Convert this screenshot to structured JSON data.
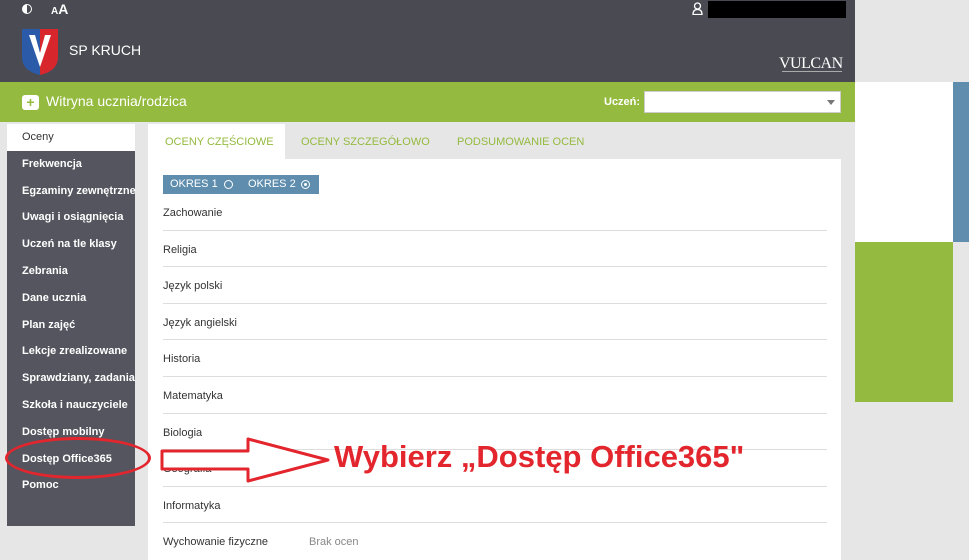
{
  "header": {
    "font_size_small": "A",
    "font_size_large": "A",
    "school_name": "SP KRUCH",
    "vendor_logo": "VULCAN"
  },
  "site": {
    "title": "Witryna ucznia/rodzica",
    "student_label": "Uczeń:",
    "student_value": ""
  },
  "sidebar": {
    "items": [
      {
        "label": "Oceny"
      },
      {
        "label": "Frekwencja"
      },
      {
        "label": "Egzaminy zewnętrzne"
      },
      {
        "label": "Uwagi i osiągnięcia"
      },
      {
        "label": "Uczeń na tle klasy"
      },
      {
        "label": "Zebrania"
      },
      {
        "label": "Dane ucznia"
      },
      {
        "label": "Plan zajęć"
      },
      {
        "label": "Lekcje zrealizowane"
      },
      {
        "label": "Sprawdziany, zadania"
      },
      {
        "label": "Szkoła i nauczyciele"
      },
      {
        "label": "Dostęp mobilny"
      },
      {
        "label": "Dostęp Office365"
      },
      {
        "label": "Pomoc"
      }
    ]
  },
  "tabs": [
    {
      "label": "OCENY CZĘŚCIOWE"
    },
    {
      "label": "OCENY SZCZEGÓŁOWO"
    },
    {
      "label": "PODSUMOWANIE OCEN"
    }
  ],
  "periods": [
    {
      "label": "OKRES 1",
      "selected": false
    },
    {
      "label": "OKRES 2",
      "selected": true
    }
  ],
  "subjects": [
    {
      "name": "Zachowanie",
      "grades": ""
    },
    {
      "name": "Religia",
      "grades": ""
    },
    {
      "name": "Język polski",
      "grades": ""
    },
    {
      "name": "Język angielski",
      "grades": ""
    },
    {
      "name": "Historia",
      "grades": ""
    },
    {
      "name": "Matematyka",
      "grades": ""
    },
    {
      "name": "Biologia",
      "grades": ""
    },
    {
      "name": "Geografia",
      "grades": ""
    },
    {
      "name": "Informatyka",
      "grades": ""
    },
    {
      "name": "Wychowanie fizyczne",
      "grades": "Brak ocen"
    }
  ],
  "annotation": {
    "text": "Wybierz „Dostęp Office365\"",
    "color": "#e3262d"
  },
  "colors": {
    "header_dark": "#4a4a52",
    "accent_green": "#94ba3f",
    "accent_blue": "#5f8dad",
    "sidebar": "#54555e"
  },
  "icons": {
    "contrast": "contrast-icon",
    "user": "user-icon",
    "site": "plus-chat-icon",
    "dropdown": "chevron-down-icon",
    "radio": "radio-icon"
  }
}
